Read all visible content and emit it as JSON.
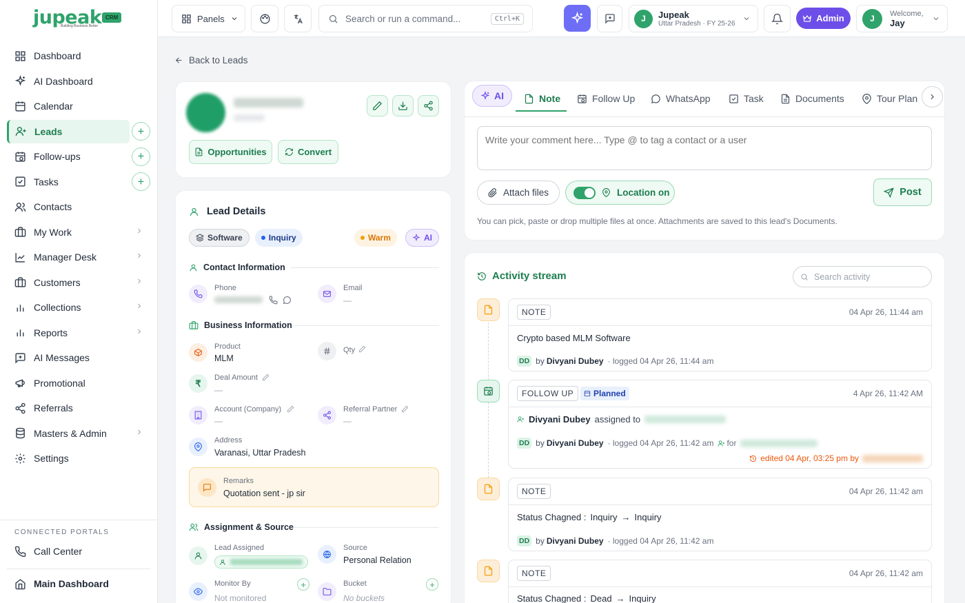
{
  "brand": {
    "name": "jupeak",
    "tagline": "Building Business Better",
    "badge": "CRM"
  },
  "sidebar": {
    "items": [
      {
        "label": "Dashboard",
        "icon": "grid-icon"
      },
      {
        "label": "AI Dashboard",
        "icon": "sparkle-icon"
      },
      {
        "label": "Calendar",
        "icon": "calendar-icon"
      },
      {
        "label": "Leads",
        "icon": "user-plus-icon",
        "active": true,
        "plus": true
      },
      {
        "label": "Follow-ups",
        "icon": "calendar-clock-icon",
        "plus": true
      },
      {
        "label": "Tasks",
        "icon": "checkbox-icon",
        "plus": true
      },
      {
        "label": "Contacts",
        "icon": "users-icon"
      },
      {
        "label": "My Work",
        "icon": "briefcase-icon",
        "chevron": true
      },
      {
        "label": "Manager Desk",
        "icon": "trend-icon",
        "chevron": true
      },
      {
        "label": "Customers",
        "icon": "briefcase-icon",
        "chevron": true
      },
      {
        "label": "Collections",
        "icon": "bar-chart-icon",
        "chevron": true
      },
      {
        "label": "Reports",
        "icon": "bar-chart-icon",
        "chevron": true
      },
      {
        "label": "AI Messages",
        "icon": "message-plus-icon"
      },
      {
        "label": "Promotional",
        "icon": "megaphone-icon"
      },
      {
        "label": "Referrals",
        "icon": "share-icon"
      },
      {
        "label": "Masters & Admin",
        "icon": "database-icon",
        "chevron": true
      },
      {
        "label": "Settings",
        "icon": "gear-icon"
      }
    ],
    "portals_title": "CONNECTED PORTALS",
    "call_center": "Call Center",
    "main_dashboard": "Main Dashboard"
  },
  "topbar": {
    "panels": "Panels",
    "search_placeholder": "Search or run a command...",
    "shortcut": "Ctrl+K",
    "company": "Jupeak",
    "company_sub": "Uttar Pradesh · FY 25-26",
    "company_initial": "J",
    "admin": "Admin",
    "welcome": "Welcome,",
    "user": "Jay",
    "user_initial": "J"
  },
  "back": "Back to Leads",
  "lead": {
    "opportunities": "Opportunities",
    "convert": "Convert"
  },
  "details": {
    "title": "Lead Details",
    "tags": {
      "software": "Software",
      "inquiry": "Inquiry",
      "warm": "Warm",
      "ai": "AI"
    },
    "contact_title": "Contact Information",
    "phone_label": "Phone",
    "email_label": "Email",
    "email_value": "—",
    "business_title": "Business Information",
    "product_label": "Product",
    "product_value": "MLM",
    "qty_label": "Qty",
    "deal_label": "Deal Amount",
    "deal_value": "—",
    "account_label": "Account (Company)",
    "account_value": "—",
    "referral_label": "Referral Partner",
    "referral_value": "—",
    "address_label": "Address",
    "address_value": "Varanasi, Uttar Pradesh",
    "remarks_label": "Remarks",
    "remarks_value": "Quotation sent - jp sir",
    "assign_title": "Assignment & Source",
    "assigned_label": "Lead Assigned",
    "source_label": "Source",
    "source_value": "Personal Relation",
    "monitor_label": "Monitor By",
    "monitor_value": "Not monitored",
    "bucket_label": "Bucket",
    "bucket_value": "No buckets"
  },
  "tabs": [
    "AI",
    "Note",
    "Follow Up",
    "WhatsApp",
    "Task",
    "Documents",
    "Tour Plan"
  ],
  "composer": {
    "placeholder": "Write your comment here... Type @ to tag a contact or a user",
    "attach": "Attach files",
    "location": "Location on",
    "post": "Post",
    "hint": "You can pick, paste or drop multiple files at once. Attachments are saved to this lead's Documents."
  },
  "activity": {
    "title": "Activity stream",
    "search_placeholder": "Search activity",
    "items": [
      {
        "type": "NOTE",
        "time": "04 Apr 26, 11:44 am",
        "text": "Crypto based MLM Software",
        "initials": "DD",
        "by": "by",
        "author": "Divyani Dubey",
        "logged": "· logged 04 Apr 26, 11:44 am"
      },
      {
        "type": "FOLLOW UP",
        "status": "Planned",
        "time": "4 Apr 26, 11:42 AM",
        "assigner": "Divyani Dubey",
        "assigned_to": "assigned to",
        "initials": "DD",
        "by": "by",
        "author": "Divyani Dubey",
        "logged": "· logged 04 Apr 26, 11:42 am",
        "for": "for",
        "edited": "edited 04 Apr, 03:25 pm by"
      },
      {
        "type": "NOTE",
        "time": "04 Apr 26, 11:42 am",
        "text_a": "Status Chagned :",
        "from": "Inquiry",
        "to": "Inquiry",
        "initials": "DD",
        "by": "by",
        "author": "Divyani Dubey",
        "logged": "· logged 04 Apr 26, 11:42 am"
      },
      {
        "type": "NOTE",
        "time": "04 Apr 26, 11:42 am",
        "text_a": "Status Chagned :",
        "from": "Dead",
        "to": "Inquiry"
      }
    ]
  },
  "colors": {
    "brand": "#2fa36b",
    "admin": "#6d4ee8",
    "ai_btn": "#6d6ef5",
    "warm": "#f59e0b",
    "inquiry": "#2563eb"
  }
}
